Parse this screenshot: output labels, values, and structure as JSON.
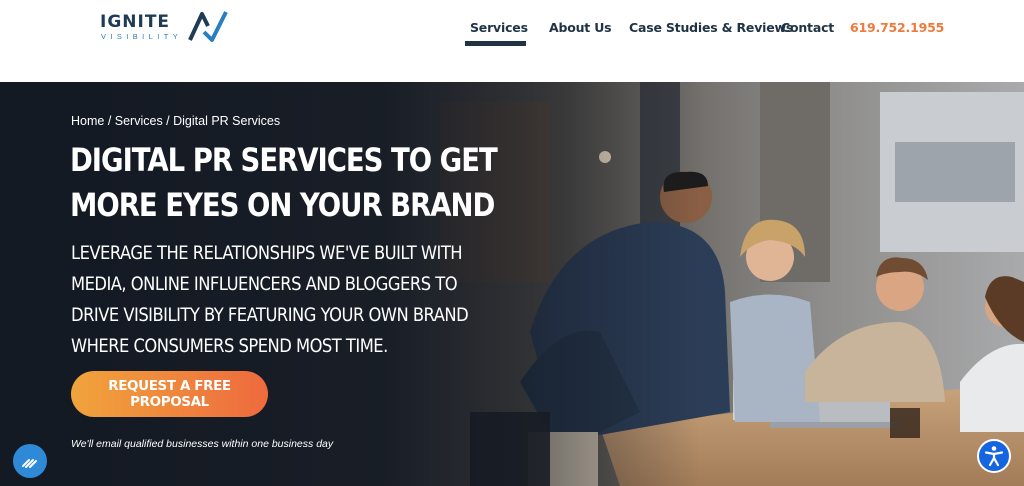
{
  "header": {
    "logo": {
      "name": "IGNITE",
      "sub": "VISIBILITY"
    },
    "nav": [
      {
        "label": "Services",
        "active": true
      },
      {
        "label": "About Us",
        "active": false
      },
      {
        "label": "Case Studies & Reviews",
        "active": false
      },
      {
        "label": "Contact",
        "active": false
      }
    ],
    "phone": "619.752.1955"
  },
  "hero": {
    "breadcrumb": [
      "Home",
      "Services",
      "Digital PR Services"
    ],
    "breadcrumb_separator": " / ",
    "title_line1": "DIGITAL PR SERVICES TO GET",
    "title_line2": "MORE EYES ON YOUR BRAND",
    "subtitle_lines": [
      "LEVERAGE THE RELATIONSHIPS WE'VE BUILT WITH",
      "MEDIA, ONLINE INFLUENCERS AND BLOGGERS TO",
      "DRIVE VISIBILITY BY FEATURING YOUR OWN BRAND",
      "WHERE CONSUMERS SPEND MOST TIME."
    ],
    "cta_label": "REQUEST A FREE PROPOSAL",
    "cta_note": "We'll email qualified businesses within one business day"
  },
  "widgets": {
    "left_icon": "chat-icon",
    "right_icon": "accessibility-icon"
  },
  "colors": {
    "accent_orange": "#f07a3c",
    "nav_dark": "#1f3344",
    "widget_blue": "#1565e0"
  }
}
